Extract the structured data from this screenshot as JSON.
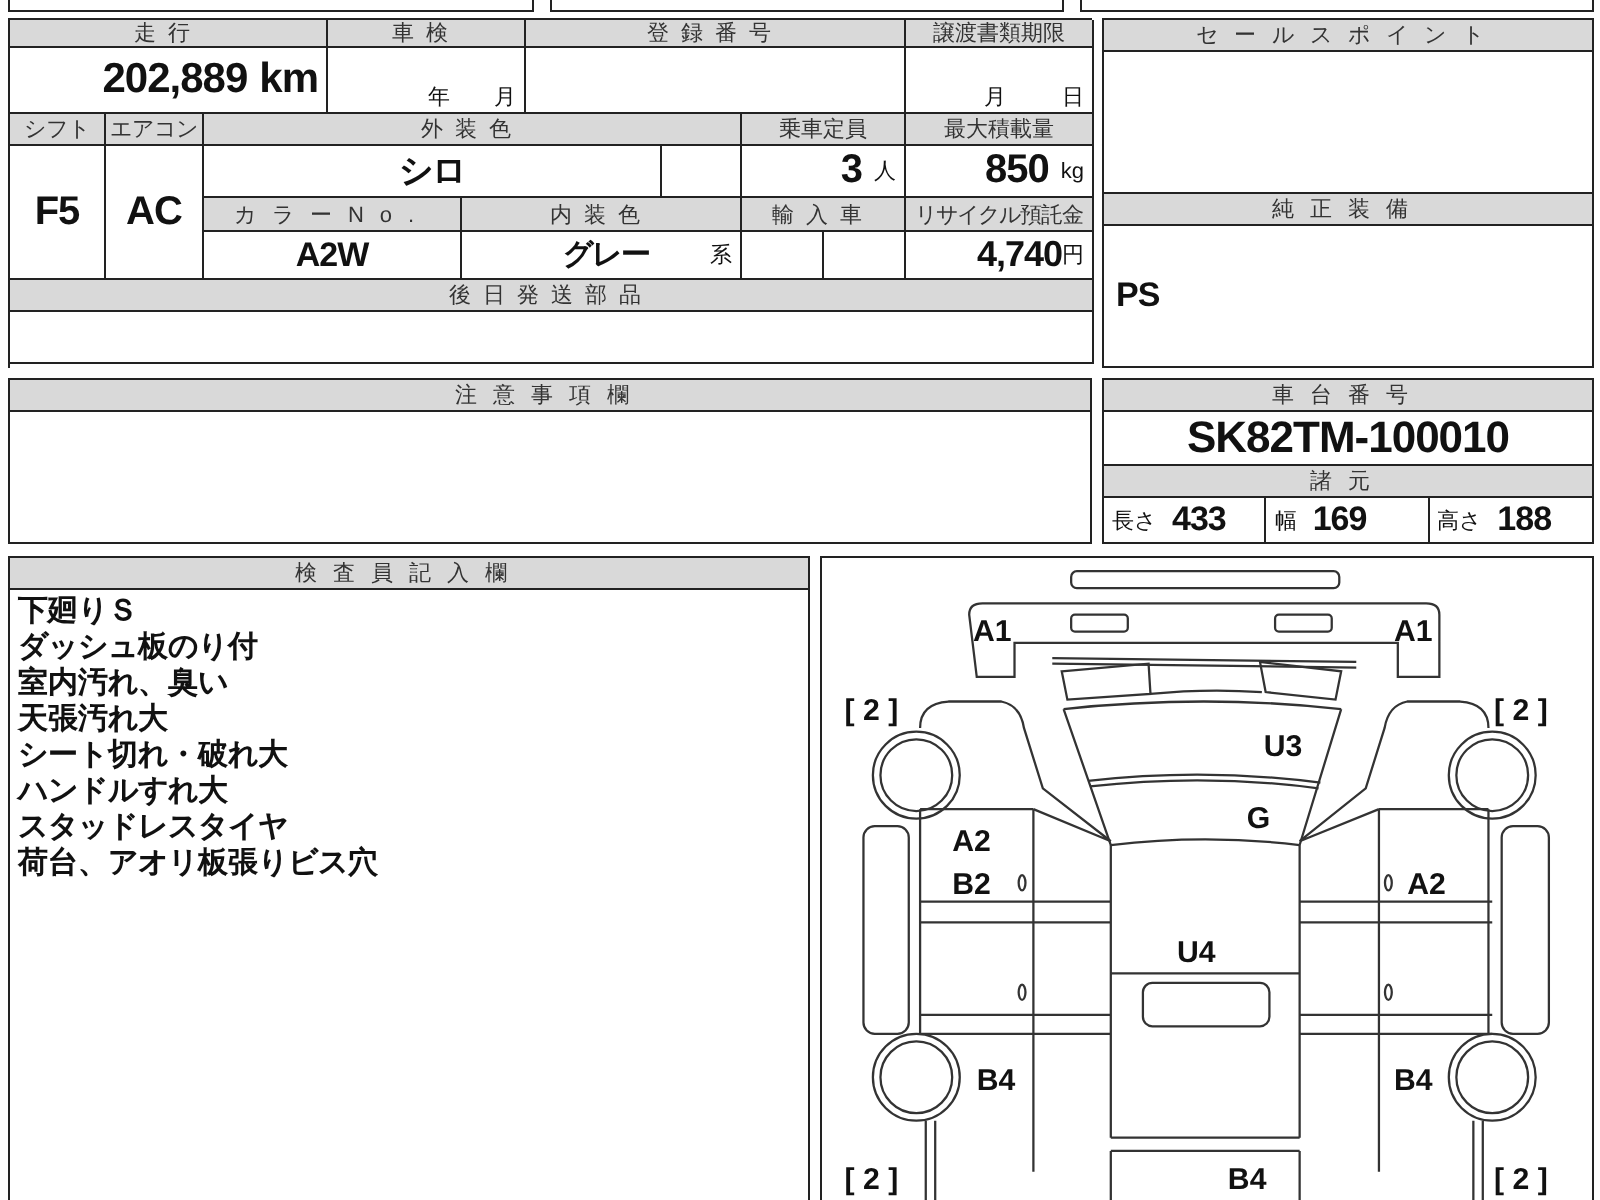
{
  "mileage": {
    "label": "走行",
    "value": "202,889",
    "unit": "km"
  },
  "inspection": {
    "label": "車検",
    "year_unit": "年",
    "month_unit": "月"
  },
  "registration": {
    "label": "登録番号"
  },
  "transfer_deadline": {
    "label": "譲渡書類期限",
    "month_unit": "月",
    "day_unit": "日"
  },
  "shift": {
    "label": "シフト",
    "value": "F5"
  },
  "aircon": {
    "label": "エアコン",
    "value": "AC"
  },
  "exterior_color": {
    "label": "外装色",
    "value": "シロ"
  },
  "capacity": {
    "label": "乗車定員",
    "value": "3",
    "unit": "人"
  },
  "max_load": {
    "label": "最大積載量",
    "value": "850",
    "unit": "kg"
  },
  "color_no": {
    "label": "カラーNo.",
    "value": "A2W"
  },
  "interior_color": {
    "label": "内装色",
    "value": "グレー",
    "suffix": "系"
  },
  "imported": {
    "label": "輸入車"
  },
  "recycle_fee": {
    "label": "リサイクル預託金",
    "value": "4,740",
    "unit": "円"
  },
  "later_parts": {
    "label": "後日発送部品"
  },
  "sale_points": {
    "label": "セールスポイント"
  },
  "genuine_equipment": {
    "label": "純正装備",
    "value": "PS"
  },
  "notes": {
    "label": "注意事項欄"
  },
  "chassis": {
    "label": "車台番号",
    "value": "SK82TM-100010"
  },
  "specs": {
    "label": "諸元",
    "items": [
      {
        "label": "長さ",
        "value": "433"
      },
      {
        "label": "幅",
        "value": "169"
      },
      {
        "label": "高さ",
        "value": "188"
      }
    ]
  },
  "inspector_notes": {
    "label": "検査員記入欄",
    "lines": [
      "下廻りＳ",
      "ダッシュ板のり付",
      "室内汚れ、臭い",
      "天張汚れ大",
      "シート切れ・破れ大",
      "ハンドルすれ大",
      "スタッドレスタイヤ",
      "荷台、アオリ板張りビス穴"
    ]
  },
  "diagram": {
    "marks": [
      {
        "text": "A1"
      },
      {
        "text": "A1"
      },
      {
        "text": "[ 2 ]"
      },
      {
        "text": "[ 2 ]"
      },
      {
        "text": "U3"
      },
      {
        "text": "G"
      },
      {
        "text": "A2"
      },
      {
        "text": "B2"
      },
      {
        "text": "A2"
      },
      {
        "text": "U4"
      },
      {
        "text": "B4"
      },
      {
        "text": "B4"
      },
      {
        "text": "[ 2 ]"
      },
      {
        "text": "B4"
      },
      {
        "text": "[ 2 ]"
      }
    ]
  }
}
